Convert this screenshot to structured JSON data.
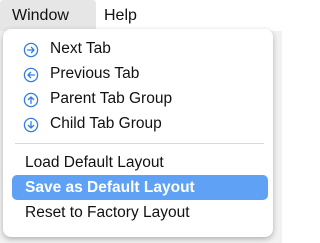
{
  "menubar": {
    "items": [
      {
        "label": "Window",
        "active": true
      },
      {
        "label": "Help",
        "active": false
      }
    ]
  },
  "dropdown": {
    "tab_items": [
      {
        "label": "Next Tab",
        "icon": "arrow-right-circle-icon"
      },
      {
        "label": "Previous Tab",
        "icon": "arrow-left-circle-icon"
      },
      {
        "label": "Parent Tab Group",
        "icon": "arrow-up-circle-icon"
      },
      {
        "label": "Child Tab Group",
        "icon": "arrow-down-circle-icon"
      }
    ],
    "layout_items": [
      {
        "label": "Load Default Layout",
        "highlighted": false
      },
      {
        "label": "Save as Default Layout",
        "highlighted": true
      },
      {
        "label": "Reset to Factory Layout",
        "highlighted": false
      }
    ]
  },
  "colors": {
    "icon_blue": "#2f7de1",
    "highlight": "#5fa2f5"
  }
}
